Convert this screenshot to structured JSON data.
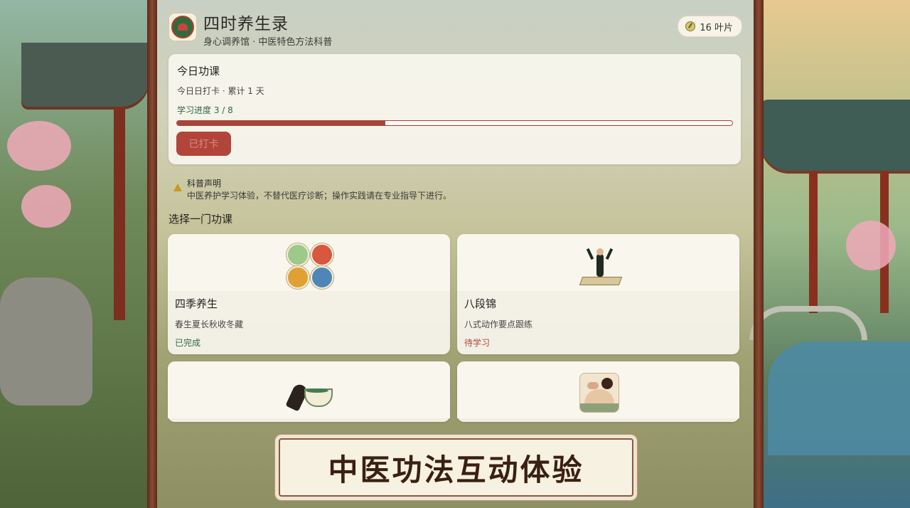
{
  "app": {
    "title": "四时养生录",
    "subtitle": "身心调养馆 · 中医特色方法科普",
    "leaf_count": "16 叶片"
  },
  "daily": {
    "title": "今日功课",
    "checkin_text": "今日日打卡 · 累计 1 天",
    "progress_label": "学习进度  3 / 8",
    "progress_value": 0.375,
    "checked_button": "已打卡"
  },
  "disclaimer": {
    "title": "科普声明",
    "text": "中医养护学习体验，不替代医疗诊断；操作实践请在专业指导下进行。"
  },
  "section": {
    "title": "选择一门功课"
  },
  "courses": [
    {
      "name": "四季养生",
      "desc": "春生夏长秋收冬藏",
      "status": "已完成",
      "icon": "four-seasons-icon"
    },
    {
      "name": "八段锦",
      "desc": "八式动作要点跟练",
      "status": "待学习",
      "icon": "baduanjin-figure-icon"
    },
    {
      "name": "",
      "desc": "",
      "status": "",
      "icon": "guasha-tea-icon"
    },
    {
      "name": "",
      "desc": "",
      "status": "",
      "icon": "massage-icon"
    }
  ],
  "banner": {
    "text": "中医功法互动体验"
  },
  "colors": {
    "accent_red": "#b2453a",
    "accent_green": "#2e6a49",
    "card_bg": "#f9f6ee",
    "frame_wood": "#6b3526"
  }
}
